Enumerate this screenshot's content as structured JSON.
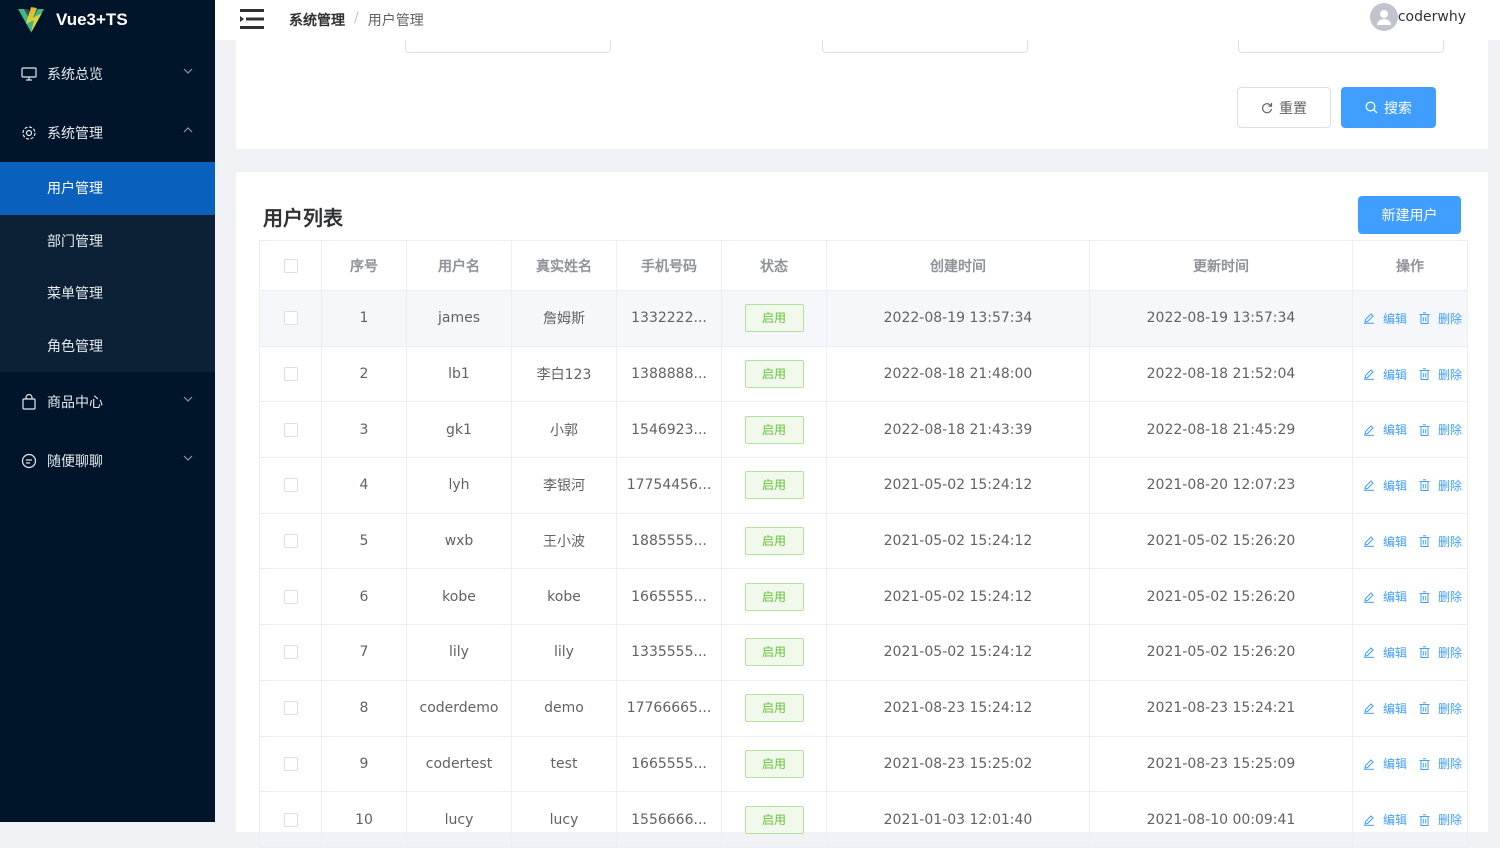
{
  "app": {
    "name": "Vue3+TS"
  },
  "sidebar": {
    "groups": [
      {
        "label": "系统总览",
        "icon": "monitor-icon"
      },
      {
        "label": "系统管理",
        "icon": "setting-icon"
      },
      {
        "label": "商品中心",
        "icon": "shop-bag-icon"
      },
      {
        "label": "随便聊聊",
        "icon": "chat-icon"
      }
    ],
    "sub_items": [
      {
        "label": "用户管理",
        "active": true
      },
      {
        "label": "部门管理"
      },
      {
        "label": "菜单管理"
      },
      {
        "label": "角色管理"
      }
    ]
  },
  "header": {
    "breadcrumb": [
      "系统管理",
      "用户管理"
    ],
    "separator": "/",
    "username": "coderwhy"
  },
  "search": {
    "reset_label": "重置",
    "search_label": "搜索"
  },
  "list": {
    "title": "用户列表",
    "new_label": "新建用户",
    "columns": [
      "序号",
      "用户名",
      "真实姓名",
      "手机号码",
      "状态",
      "创建时间",
      "更新时间",
      "操作"
    ],
    "edit_label": "编辑",
    "delete_label": "删除",
    "status_label": "启用",
    "rows": [
      {
        "index": "1",
        "name": "james",
        "realname": "詹姆斯",
        "phone": "1332222...",
        "created": "2022-08-19 13:57:34",
        "updated": "2022-08-19 13:57:34"
      },
      {
        "index": "2",
        "name": "lb1",
        "realname": "李白123",
        "phone": "1388888...",
        "created": "2022-08-18 21:48:00",
        "updated": "2022-08-18 21:52:04"
      },
      {
        "index": "3",
        "name": "gk1",
        "realname": "小郭",
        "phone": "1546923...",
        "created": "2022-08-18 21:43:39",
        "updated": "2022-08-18 21:45:29"
      },
      {
        "index": "4",
        "name": "lyh",
        "realname": "李银河",
        "phone": "17754456...",
        "created": "2021-05-02 15:24:12",
        "updated": "2021-08-20 12:07:23"
      },
      {
        "index": "5",
        "name": "wxb",
        "realname": "王小波",
        "phone": "1885555...",
        "created": "2021-05-02 15:24:12",
        "updated": "2021-05-02 15:26:20"
      },
      {
        "index": "6",
        "name": "kobe",
        "realname": "kobe",
        "phone": "1665555...",
        "created": "2021-05-02 15:24:12",
        "updated": "2021-05-02 15:26:20"
      },
      {
        "index": "7",
        "name": "lily",
        "realname": "lily",
        "phone": "1335555...",
        "created": "2021-05-02 15:24:12",
        "updated": "2021-05-02 15:26:20"
      },
      {
        "index": "8",
        "name": "coderdemo",
        "realname": "demo",
        "phone": "17766665...",
        "created": "2021-08-23 15:24:12",
        "updated": "2021-08-23 15:24:21"
      },
      {
        "index": "9",
        "name": "codertest",
        "realname": "test",
        "phone": "1665555...",
        "created": "2021-08-23 15:25:02",
        "updated": "2021-08-23 15:25:09"
      },
      {
        "index": "10",
        "name": "lucy",
        "realname": "lucy",
        "phone": "1556666...",
        "created": "2021-01-03 12:01:40",
        "updated": "2021-08-10 00:09:41"
      }
    ]
  }
}
